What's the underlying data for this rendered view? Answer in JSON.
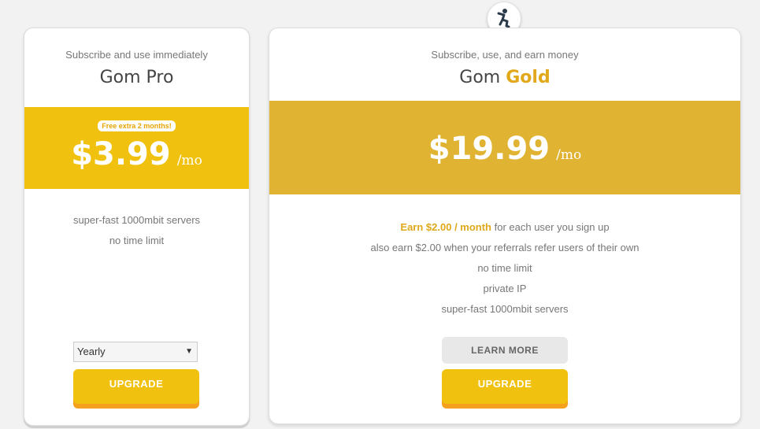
{
  "pro": {
    "subtitle": "Subscribe and use immediately",
    "name": "Gom Pro",
    "badge": "Free extra 2 months!",
    "price": "$3.99",
    "per": "/mo",
    "features": [
      "super-fast 1000mbit servers",
      "no time limit"
    ],
    "billing_selected": "Yearly",
    "upgrade_label": "UPGRADE"
  },
  "gold": {
    "subtitle": "Subscribe, use, and earn money",
    "name_prefix": "Gom",
    "name_accent": "Gold",
    "price": "$19.99",
    "per": "/mo",
    "earn_highlight": "Earn $2.00 / month",
    "earn_rest": " for each user you sign up",
    "features": [
      "also earn $2.00 when your referrals refer users of their own",
      "no time limit",
      "private IP",
      "super-fast 1000mbit servers"
    ],
    "learn_more_label": "LEARN MORE",
    "upgrade_label": "UPGRADE"
  },
  "colors": {
    "pro_band": "#f0c20f",
    "gold_band": "#e1b332",
    "accent_text": "#e0a81a",
    "button_shadow": "#f5a11d"
  },
  "icons": {
    "logo": "running-figure-logo-icon",
    "select_arrow": "triangle-down-icon"
  }
}
